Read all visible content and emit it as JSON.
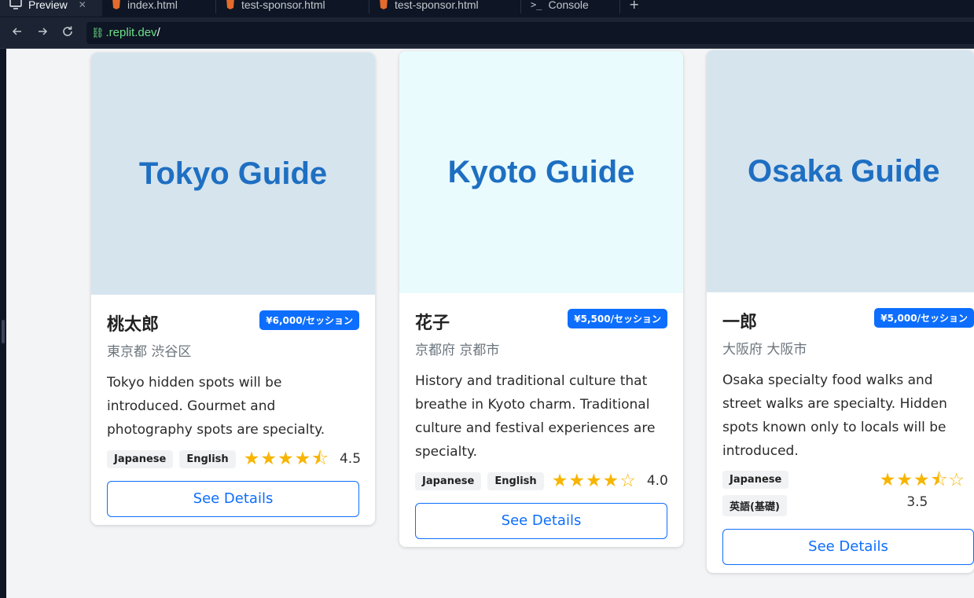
{
  "browser": {
    "tabs": [
      {
        "label": "Preview",
        "icon": "monitor-icon",
        "active": true
      },
      {
        "label": "index.html",
        "icon": "html-file-icon",
        "active": false
      },
      {
        "label": "test-sponsor.html",
        "icon": "html-file-icon",
        "active": false
      },
      {
        "label": "test-sponsor.html",
        "icon": "html-file-icon",
        "active": false
      },
      {
        "label": "Console",
        "icon": "terminal-icon",
        "active": false
      }
    ],
    "add_tab": "+",
    "url_host": ".replit.dev",
    "url_path": "/"
  },
  "accent_color": "#0d6efd",
  "star_color": "#f7b500",
  "cards": [
    {
      "image_text": "Tokyo Guide",
      "image_bg": "#d6e4ee",
      "name": "桃太郎",
      "price": "¥6,000/セッション",
      "location": "東京都 渋谷区",
      "description": "Tokyo hidden spots will be introduced. Gourmet and photography spots are specialty.",
      "languages": [
        "Japanese",
        "English"
      ],
      "rating": "4.5",
      "stars": 4.5,
      "button": "See Details"
    },
    {
      "image_text": "Kyoto Guide",
      "image_bg": "#e9fbfd",
      "name": "花子",
      "price": "¥5,500/セッション",
      "location": "京都府 京都市",
      "description": "History and traditional culture that breathe in Kyoto charm. Traditional culture and festival experiences are specialty.",
      "languages": [
        "Japanese",
        "English"
      ],
      "rating": "4.0",
      "stars": 4,
      "button": "See Details"
    },
    {
      "image_text": "Osaka Guide",
      "image_bg": "#d6e4ee",
      "name": "一郎",
      "price": "¥5,000/セッション",
      "location": "大阪府 大阪市",
      "description": "Osaka specialty food walks and street walks are specialty. Hidden spots known only to locals will be introduced.",
      "languages": [
        "Japanese",
        "英語(基礎)"
      ],
      "rating": "3.5",
      "stars": 3.5,
      "button": "See Details"
    }
  ]
}
